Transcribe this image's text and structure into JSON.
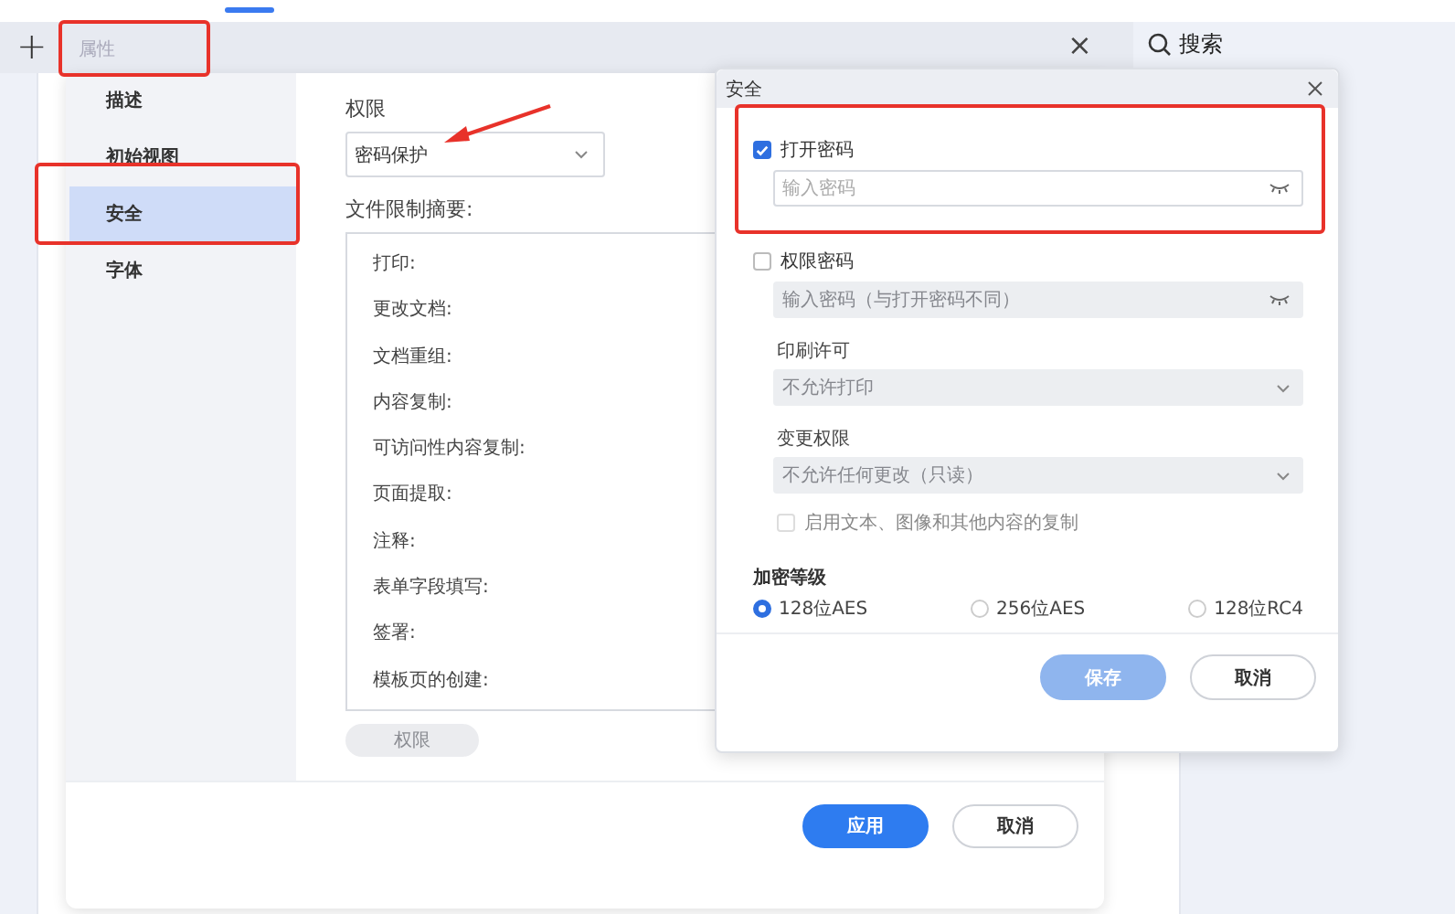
{
  "toolbar": {
    "new_tab": "+",
    "tab_title": "属性",
    "close": "×",
    "search": "搜索"
  },
  "properties": {
    "sidebar": [
      {
        "label": "描述",
        "selected": false
      },
      {
        "label": "初始视图",
        "selected": false
      },
      {
        "label": "安全",
        "selected": true
      },
      {
        "label": "字体",
        "selected": false
      }
    ],
    "permission_label": "权限",
    "permission_select": "密码保护",
    "summary_label": "文件限制摘要:",
    "summary_items": [
      "打印:",
      "更改文档:",
      "文档重组:",
      "内容复制:",
      "可访问性内容复制:",
      "页面提取:",
      "注释:",
      "表单字段填写:",
      "签署:",
      "模板页的创建:"
    ],
    "permission_button": {
      "label": "权限",
      "disabled": true
    },
    "buttons": [
      {
        "label": "应用",
        "kind": "primary",
        "disabled": false
      },
      {
        "label": "取消",
        "kind": "secondary"
      }
    ]
  },
  "security": {
    "title": "安全",
    "open_password": {
      "label": "打开密码",
      "checked": true,
      "placeholder": "输入密码"
    },
    "permission_password": {
      "label": "权限密码",
      "checked": false,
      "placeholder": "输入密码（与打开密码不同）"
    },
    "selects": [
      {
        "label": "印刷许可",
        "value": "不允许打印",
        "disabled": true
      },
      {
        "label": "变更权限",
        "value": "不允许任何更改（只读）",
        "disabled": true
      }
    ],
    "copy": {
      "label": "启用文本、图像和其他内容的复制",
      "checked": false,
      "disabled": true
    },
    "encryption": {
      "label": "加密等级",
      "options": [
        {
          "label": "128位AES",
          "selected": true
        },
        {
          "label": "256位AES",
          "selected": false
        },
        {
          "label": "128位RC4",
          "selected": false
        }
      ]
    },
    "buttons": [
      {
        "label": "保存",
        "kind": "primary",
        "disabled": true
      },
      {
        "label": "取消",
        "kind": "secondary"
      }
    ]
  }
}
